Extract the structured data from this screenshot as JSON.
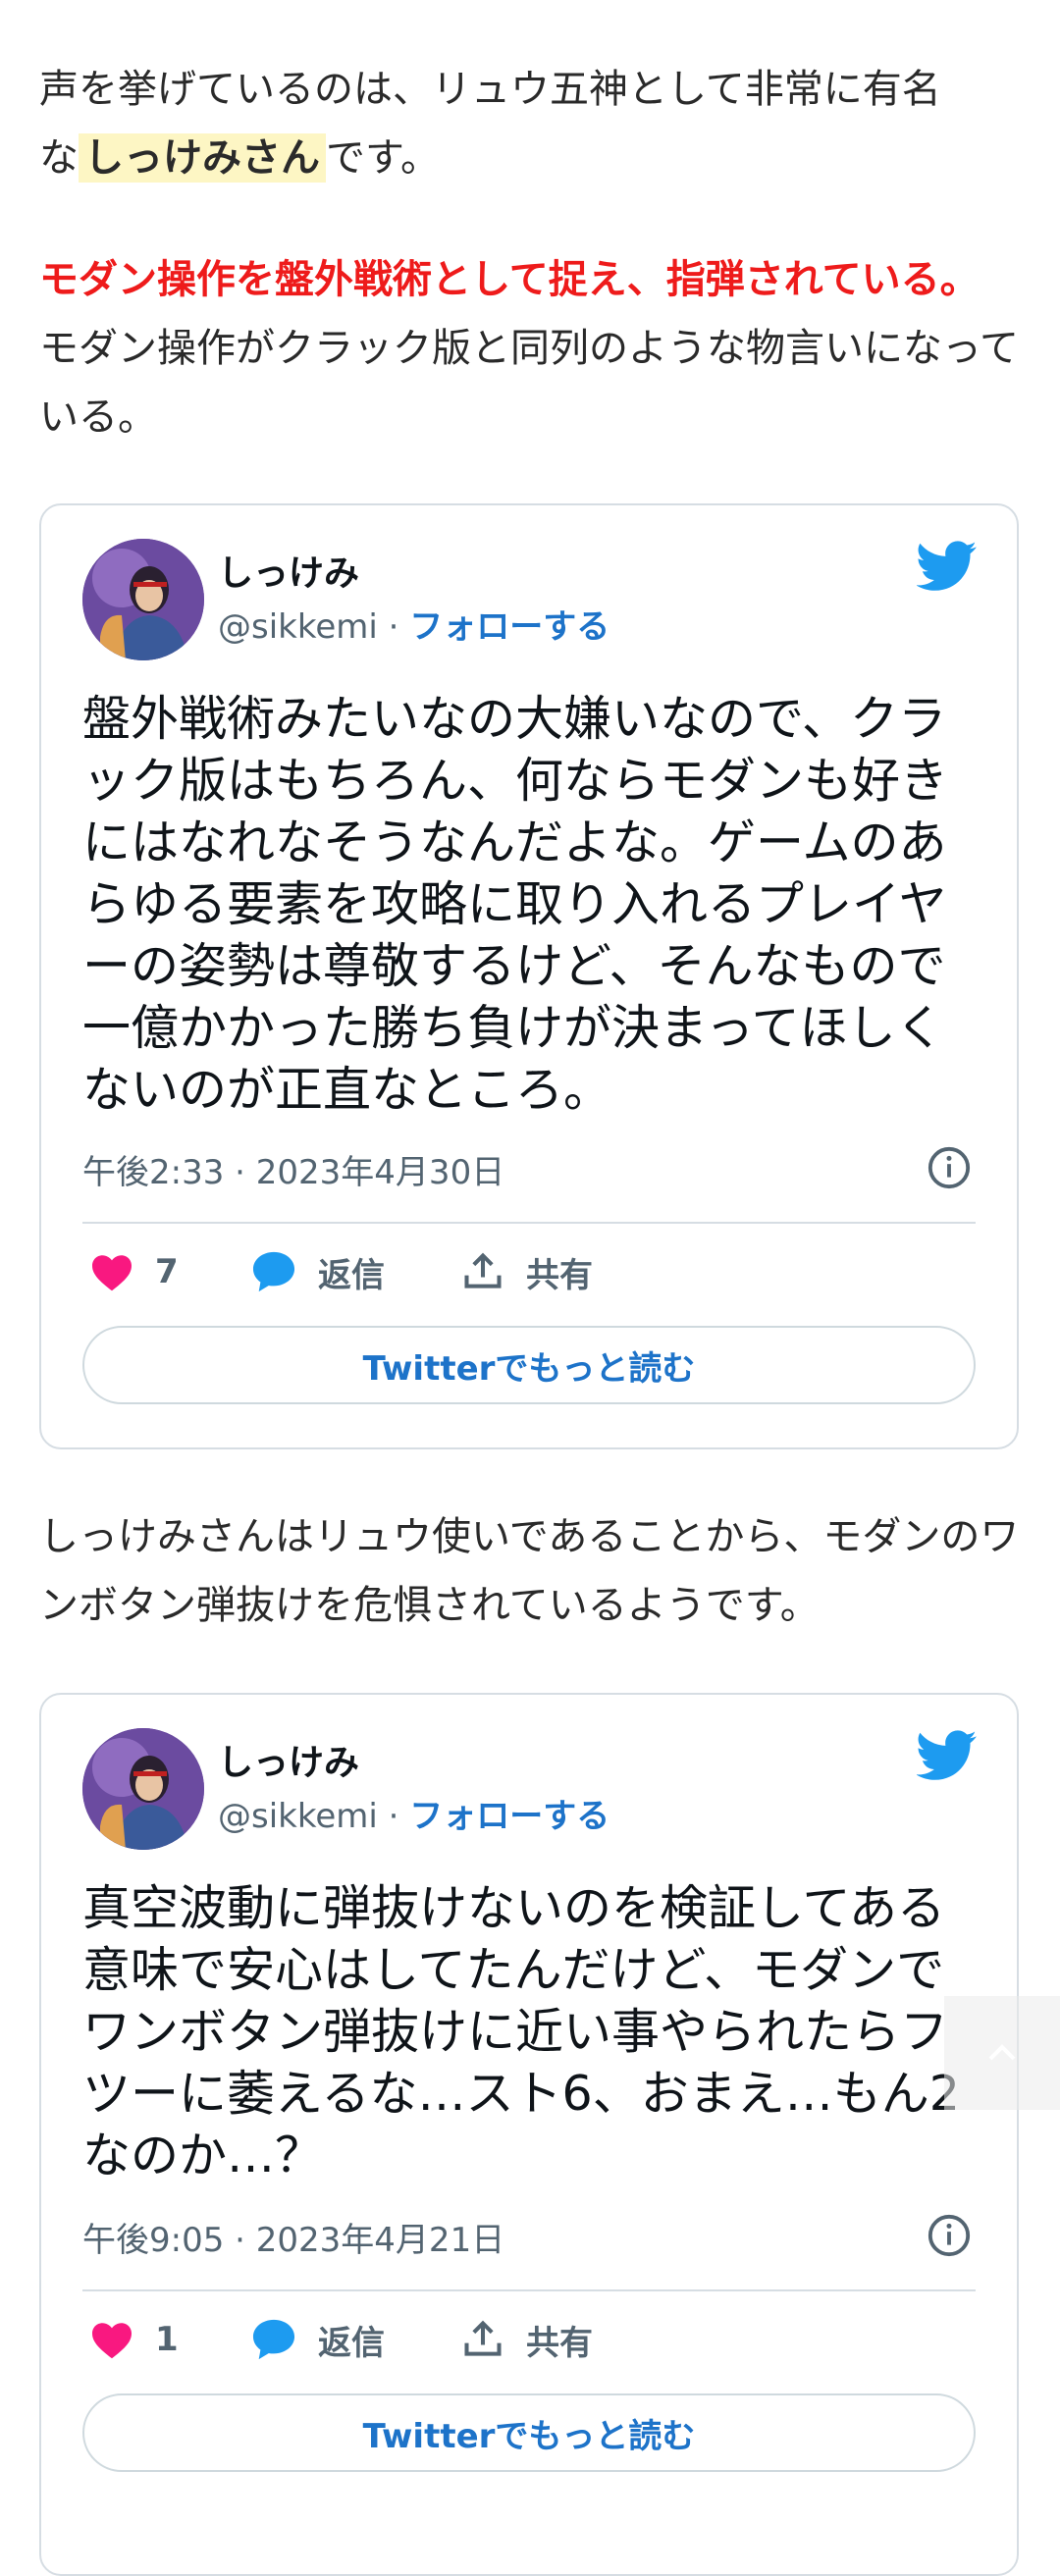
{
  "intro": {
    "line1": "声を挙げているのは、リュウ五神として非常に有名",
    "prefix": "な",
    "highlight": "しっけみさん",
    "suffix": "です。"
  },
  "point": {
    "red_text": "モダン操作を盤外戦術として捉え、指弾されている。",
    "rest": "モダン操作がクラック版と同列のような物言いになっている。"
  },
  "middle_paragraph": "しっけみさんはリュウ使いであることから、モダンのワンボタン弾抜けを危惧されているようです。",
  "tweets": [
    {
      "author": "しっけみ",
      "handle": "@sikkemi",
      "separator": "·",
      "follow_label": "フォローする",
      "text": "盤外戦術みたいなの大嫌いなので、クラック版はもちろん、何ならモダンも好きにはなれなそうなんだよな。ゲームのあらゆる要素を攻略に取り入れるプレイヤーの姿勢は尊敬するけど、そんなもので一億かかった勝ち負けが決まってほしくないのが正直なところ。",
      "timestamp": "午後2:33 · 2023年4月30日",
      "likes": "7",
      "reply_label": "返信",
      "share_label": "共有",
      "read_more_label": "Twitterでもっと読む"
    },
    {
      "author": "しっけみ",
      "handle": "@sikkemi",
      "separator": "·",
      "follow_label": "フォローする",
      "text": "真空波動に弾抜けないのを検証してある意味で安心はしてたんだけど、モダンでワンボタン弾抜けに近い事やられたらフツーに萎えるな…スト6、おまえ…もん2なのか…？",
      "timestamp": "午後9:05 · 2023年4月21日",
      "likes": "1",
      "reply_label": "返信",
      "share_label": "共有",
      "read_more_label": "Twitterでもっと読む"
    }
  ],
  "icons": [
    "twitter-bird-icon",
    "info-icon",
    "heart-icon",
    "reply-bubble-icon",
    "share-icon",
    "chevron-up-icon"
  ],
  "colors": {
    "accent_red": "#ee1b1b",
    "highlight_bg": "#fdf6c4",
    "twitter_blue": "#1d9bf0",
    "link_blue": "#1d73c9",
    "heart_pink": "#f91880"
  }
}
